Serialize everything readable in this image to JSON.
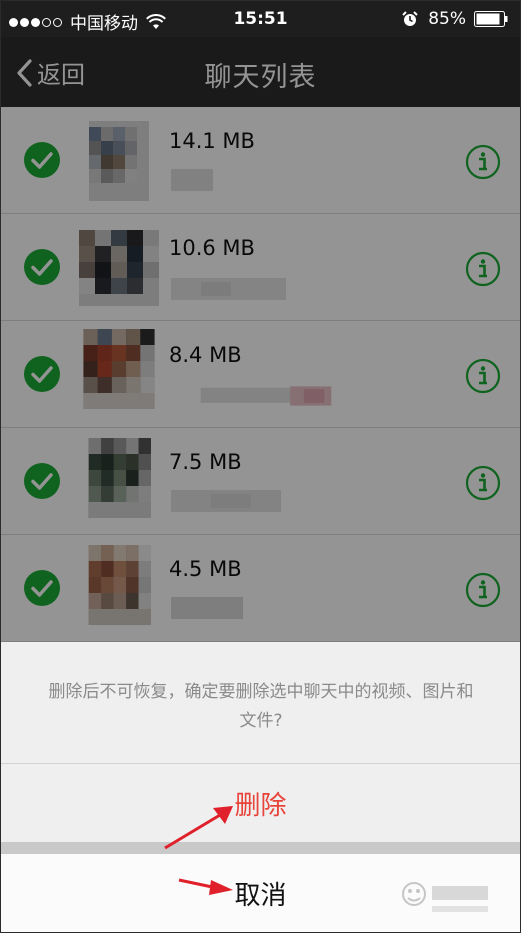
{
  "status_bar": {
    "carrier": "中国移动",
    "time": "15:51",
    "battery": "85%"
  },
  "nav": {
    "back_label": "返回",
    "title": "聊天列表"
  },
  "chats": [
    {
      "size": "14.1 MB",
      "checked": true
    },
    {
      "size": "10.6 MB",
      "checked": true
    },
    {
      "size": "8.4 MB",
      "checked": true
    },
    {
      "size": "7.5 MB",
      "checked": true
    },
    {
      "size": "4.5 MB",
      "checked": true
    }
  ],
  "dialog": {
    "message": "删除后不可恢复，确定要删除选中聊天中的视频、图片和文件?",
    "delete_label": "删除",
    "cancel_label": "取消"
  },
  "colors": {
    "accent_green": "#1aab34",
    "delete_red": "#e8433a",
    "nav_bg": "#2d2d2d",
    "annotation_red": "#e0202a"
  },
  "icons": {
    "check": "check-circle-icon",
    "info": "info-circle-icon",
    "back": "chevron-left-icon",
    "arrow": "red-arrow-icon"
  }
}
